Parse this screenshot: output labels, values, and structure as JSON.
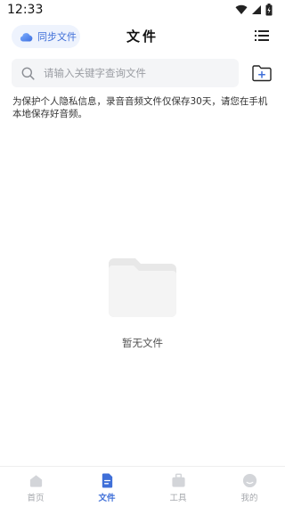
{
  "status_bar": {
    "time": "12:33"
  },
  "header": {
    "sync_label": "同步文件",
    "title": "文件"
  },
  "search": {
    "placeholder": "请输入关键字查询文件"
  },
  "notice": "为保护个人隐私信息，录音音频文件仅保存30天，请您在手机本地保存好音频。",
  "empty_state": {
    "text": "暂无文件"
  },
  "bottom_nav": {
    "items": [
      {
        "label": "首页",
        "icon": "home-icon",
        "active": false
      },
      {
        "label": "文件",
        "icon": "file-icon",
        "active": true
      },
      {
        "label": "工具",
        "icon": "toolbox-icon",
        "active": false
      },
      {
        "label": "我的",
        "icon": "profile-icon",
        "active": false
      }
    ]
  },
  "colors": {
    "accent": "#3f6fd8",
    "inactive": "#a6a8ad",
    "search_bg": "#f4f5f7",
    "sync_bg": "#eef3fd"
  }
}
